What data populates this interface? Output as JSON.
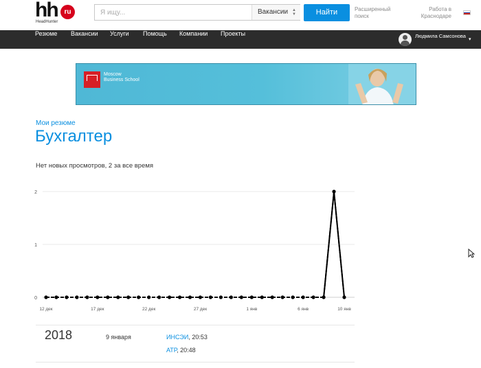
{
  "header": {
    "logo_main": "hh",
    "logo_badge": "ru",
    "logo_sub": "HeadHunter",
    "search_placeholder": "Я ищу...",
    "search_scope": "Вакансии",
    "search_button": "Найти",
    "advanced_search_line1": "Расширенный",
    "advanced_search_line2": "поиск",
    "region_line1": "Работа в",
    "region_line2": "Краснодаре"
  },
  "nav": {
    "items": [
      "Резюме",
      "Вакансии",
      "Услуги",
      "Помощь",
      "Компании",
      "Проекты"
    ],
    "user_name": "Людмила Самсонова",
    "caret": "▾"
  },
  "banner": {
    "line1": "Moscow",
    "line2": "Business School"
  },
  "content": {
    "breadcrumb": "Мои резюме",
    "title": "Бухгалтер",
    "views_summary": "Нет новых просмотров, 2 за все время"
  },
  "chart_data": {
    "type": "line",
    "x_ticks": [
      "12 дек",
      "17 дек",
      "22 дек",
      "27 дек",
      "1 янв",
      "6 янв",
      "10 янв"
    ],
    "y_ticks": [
      "0",
      "1",
      "2"
    ],
    "ylim": [
      0,
      2
    ],
    "x": [
      "12 дек",
      "13 дек",
      "14 дек",
      "15 дек",
      "16 дек",
      "17 дек",
      "18 дек",
      "19 дек",
      "20 дек",
      "21 дек",
      "22 дек",
      "23 дек",
      "24 дек",
      "25 дек",
      "26 дек",
      "27 дек",
      "28 дек",
      "29 дек",
      "30 дек",
      "31 дек",
      "1 янв",
      "2 янв",
      "3 янв",
      "4 янв",
      "5 янв",
      "6 янв",
      "7 янв",
      "8 янв",
      "9 янв",
      "10 янв"
    ],
    "values": [
      0,
      0,
      0,
      0,
      0,
      0,
      0,
      0,
      0,
      0,
      0,
      0,
      0,
      0,
      0,
      0,
      0,
      0,
      0,
      0,
      0,
      0,
      0,
      0,
      0,
      0,
      0,
      0,
      2,
      0
    ],
    "grid": true,
    "color": "#000000"
  },
  "history": {
    "year": "2018",
    "date": "9 января",
    "entries": [
      {
        "company": "ИНСЭИ",
        "time": ", 20:53"
      },
      {
        "company": "АТР",
        "time": ", 20:48"
      }
    ]
  },
  "colors": {
    "brand_blue": "#0a8fe0",
    "nav_bg": "#2c2c2c",
    "logo_red": "#d6001c"
  }
}
